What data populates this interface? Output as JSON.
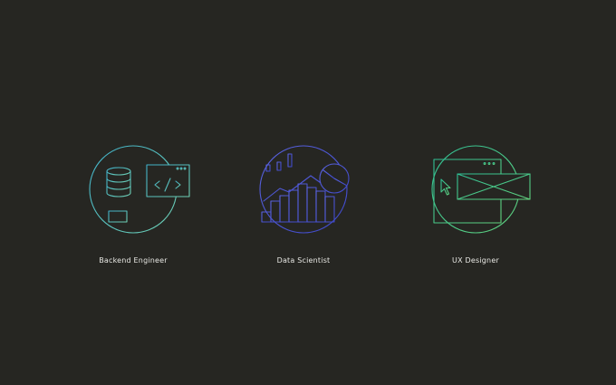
{
  "colors": {
    "background": "#262622",
    "text": "#e8e8e4",
    "backend_teal": "#4fb6c6",
    "data_blue": "#4f5fd8",
    "ux_green": "#43c48c"
  },
  "roles": [
    {
      "label": "Backend Engineer",
      "icon": "backend-engineer-icon"
    },
    {
      "label": "Data Scientist",
      "icon": "data-scientist-icon"
    },
    {
      "label": "UX Designer",
      "icon": "ux-designer-icon"
    }
  ]
}
